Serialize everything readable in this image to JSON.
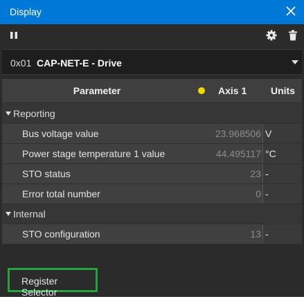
{
  "window": {
    "title": "Display",
    "accent_color": "#0078d7",
    "close_icon": "close-icon"
  },
  "toolbar": {
    "pause_icon": "pause-icon",
    "settings_icon": "gear-icon",
    "delete_icon": "trash-icon"
  },
  "drive_selector": {
    "address": "0x01",
    "name": "CAP-NET-E - Drive"
  },
  "table": {
    "headers": {
      "parameter": "Parameter",
      "axis": "Axis 1",
      "units": "Units",
      "axis_dot_color": "#f2d600"
    },
    "groups": [
      {
        "label": "Reporting",
        "rows": [
          {
            "name": "Bus voltage value",
            "value": "23.968506",
            "unit": "V"
          },
          {
            "name": "Power stage temperature 1 value",
            "value": "44.495117",
            "unit": "°C"
          },
          {
            "name": "STO status",
            "value": "23",
            "unit": "-"
          },
          {
            "name": "Error total number",
            "value": "0",
            "unit": "-"
          }
        ]
      },
      {
        "label": "Internal",
        "rows": [
          {
            "name": "STO configuration",
            "value": "13",
            "unit": "-"
          }
        ]
      }
    ]
  },
  "register_selector": {
    "label": "Register Selector",
    "highlight_color": "#22a33c"
  }
}
